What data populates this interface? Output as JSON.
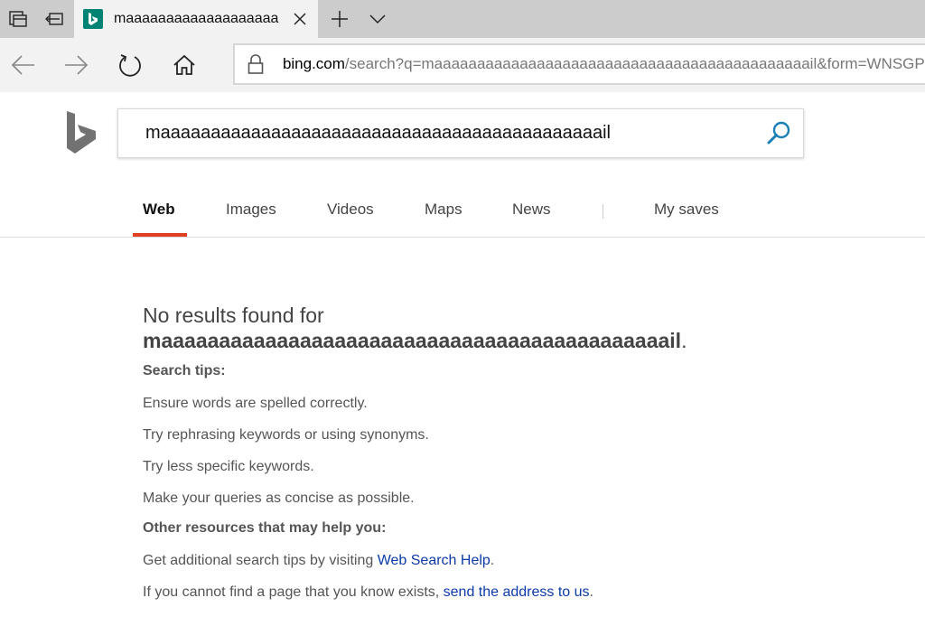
{
  "tab": {
    "title": "maaaaaaaaaaaaaaaaaaa"
  },
  "address": {
    "host": "bing.com",
    "rest": "/search?q=maaaaaaaaaaaaaaaaaaaaaaaaaaaaaaaaaaaaaaaaaaaail&form=WNSGPH"
  },
  "search": {
    "query": "maaaaaaaaaaaaaaaaaaaaaaaaaaaaaaaaaaaaaaaaaaaail"
  },
  "scopes": {
    "web": "Web",
    "images": "Images",
    "videos": "Videos",
    "maps": "Maps",
    "news": "News",
    "my_saves": "My saves"
  },
  "results": {
    "no_results_prefix": "No results found for",
    "query": "maaaaaaaaaaaaaaaaaaaaaaaaaaaaaaaaaaaaaaaaaaaail",
    "query_suffix": ".",
    "tips_heading": "Search tips:",
    "tips": [
      "Ensure words are spelled correctly.",
      "Try rephrasing keywords or using synonyms.",
      "Try less specific keywords.",
      "Make your queries as concise as possible."
    ],
    "resources_heading": "Other resources that may help you:",
    "help_prefix": "Get additional search tips by visiting ",
    "help_link": "Web Search Help",
    "help_suffix": ".",
    "address_prefix": "If you cannot find a page that you know exists, ",
    "address_link": "send the address to us",
    "address_suffix": "."
  },
  "colors": {
    "accent_underline": "#e0401f",
    "bing_teal": "#008373",
    "link": "#0d3aa8",
    "search_icon": "#1a7fb5"
  }
}
